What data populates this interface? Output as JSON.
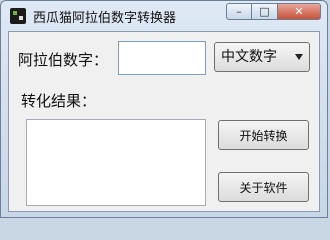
{
  "window": {
    "title": "西瓜猫阿拉伯数字转换器",
    "minimize_glyph": "–",
    "maximize_glyph": "□",
    "close_glyph": "✕"
  },
  "form": {
    "input_label": "阿拉伯数字：",
    "input_value": "",
    "mode_selected": "中文数字",
    "result_label": "转化结果：",
    "result_value": "",
    "convert_button": "开始转换",
    "about_button": "关于软件"
  },
  "icons": {
    "app": "app-icon",
    "dropdown": "chevron-down-icon"
  }
}
